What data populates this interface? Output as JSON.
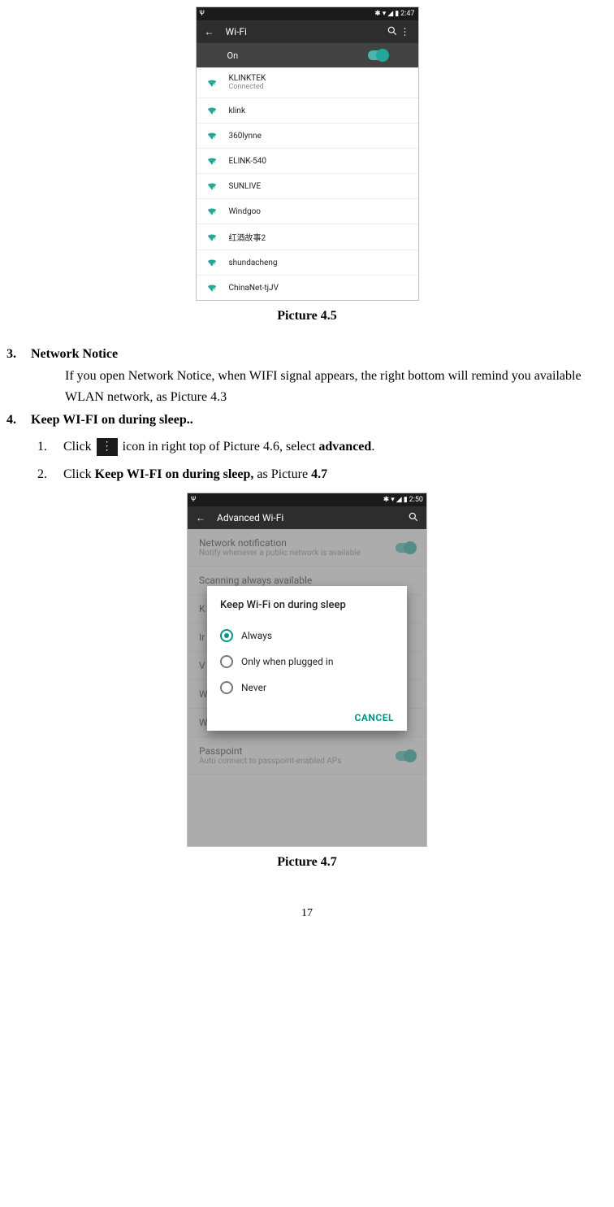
{
  "phone1": {
    "time": "2:47",
    "appbar_title": "Wi-Fi",
    "toggle_label": "On",
    "networks": [
      {
        "name": "KLINKTEK",
        "sub": "Connected"
      },
      {
        "name": "klink",
        "sub": ""
      },
      {
        "name": "360lynne",
        "sub": ""
      },
      {
        "name": "ELINK-540",
        "sub": ""
      },
      {
        "name": "SUNLIVE",
        "sub": ""
      },
      {
        "name": "Windgoo",
        "sub": ""
      },
      {
        "name": "红酒故事2",
        "sub": ""
      },
      {
        "name": "shundacheng",
        "sub": ""
      },
      {
        "name": "ChinaNet-tjJV",
        "sub": ""
      }
    ]
  },
  "caption1": "Picture 4.5",
  "section3": {
    "num": "3.",
    "heading": "Network Notice",
    "para": "If you open Network Notice, when WIFI signal appears, the right bottom will remind you available WLAN network, as Picture 4.3"
  },
  "section4": {
    "num": "4.",
    "heading": "Keep WI-FI on during sleep..",
    "step1_n": "1.",
    "step1_a": "Click",
    "step1_b": "icon in right top of Picture 4.6, select ",
    "step1_c": "advanced",
    "step1_d": ".",
    "step2_n": "2.",
    "step2_a": "Click ",
    "step2_b": "Keep WI-FI on during sleep,",
    "step2_c": " as Picture ",
    "step2_d": "4.7"
  },
  "phone2": {
    "time": "2:50",
    "appbar_title": "Advanced Wi-Fi",
    "dim_items": [
      {
        "t": "Network notification",
        "s": "Notify whenever a public network is available",
        "switch": true
      },
      {
        "t": "Scanning always available",
        "s": "",
        "switch": false
      },
      {
        "t": "K",
        "s": "",
        "switch": false
      },
      {
        "t": "Ir",
        "s": "",
        "switch": false
      },
      {
        "t": "V",
        "s": "",
        "switch": false
      },
      {
        "t": "WPS Push Button",
        "s": "",
        "switch": false
      },
      {
        "t": "WPS Pin Entry",
        "s": "",
        "switch": false
      },
      {
        "t": "Passpoint",
        "s": "Auto connect to passpoint-enabled APs",
        "switch": true
      }
    ],
    "dialog_title": "Keep Wi-Fi on during sleep",
    "options": [
      {
        "label": "Always",
        "selected": true
      },
      {
        "label": "Only when plugged in",
        "selected": false
      },
      {
        "label": "Never",
        "selected": false
      }
    ],
    "cancel": "CANCEL"
  },
  "caption2": "Picture 4.7",
  "page_number": "17"
}
